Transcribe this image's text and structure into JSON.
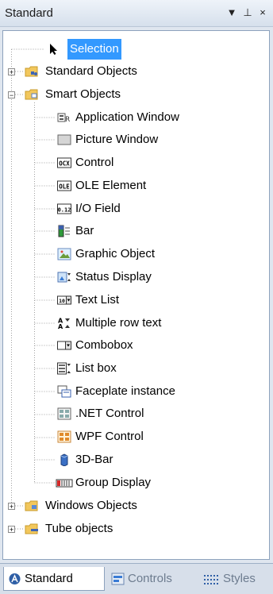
{
  "window": {
    "title": "Standard",
    "dropdown_glyph": "▼",
    "pin_glyph": "⊥",
    "close_glyph": "×"
  },
  "tree": {
    "nodes": [
      {
        "label": "Selection",
        "icon": "selection-arrow-icon",
        "level": 0,
        "expander": null,
        "selected": true
      },
      {
        "label": "Standard Objects",
        "icon": "standard-objects-folder-icon",
        "level": 0,
        "expander": "+"
      },
      {
        "label": "Smart Objects",
        "icon": "smart-objects-folder-icon",
        "level": 0,
        "expander": "−"
      },
      {
        "label": "Application Window",
        "icon": "application-window-icon",
        "level": 1
      },
      {
        "label": "Picture Window",
        "icon": "picture-window-icon",
        "level": 1
      },
      {
        "label": "Control",
        "icon": "ocx-control-icon",
        "level": 1,
        "badge": "OCX"
      },
      {
        "label": "OLE Element",
        "icon": "ole-element-icon",
        "level": 1,
        "badge": "OLE"
      },
      {
        "label": "I/O Field",
        "icon": "io-field-icon",
        "level": 1,
        "badge": "0.12"
      },
      {
        "label": "Bar",
        "icon": "bar-icon",
        "level": 1
      },
      {
        "label": "Graphic Object",
        "icon": "graphic-object-icon",
        "level": 1
      },
      {
        "label": "Status Display",
        "icon": "status-display-icon",
        "level": 1
      },
      {
        "label": "Text List",
        "icon": "text-list-icon",
        "level": 1
      },
      {
        "label": "Multiple row text",
        "icon": "multiple-row-text-icon",
        "level": 1
      },
      {
        "label": "Combobox",
        "icon": "combobox-icon",
        "level": 1
      },
      {
        "label": "List box",
        "icon": "list-box-icon",
        "level": 1
      },
      {
        "label": "Faceplate instance",
        "icon": "faceplate-instance-icon",
        "level": 1
      },
      {
        "label": ".NET Control",
        "icon": "net-control-icon",
        "level": 1
      },
      {
        "label": "WPF Control",
        "icon": "wpf-control-icon",
        "level": 1
      },
      {
        "label": "3D-Bar",
        "icon": "3d-bar-icon",
        "level": 1
      },
      {
        "label": "Group Display",
        "icon": "group-display-icon",
        "level": 1
      },
      {
        "label": "Windows Objects",
        "icon": "windows-objects-folder-icon",
        "level": 0,
        "expander": "+"
      },
      {
        "label": "Tube objects",
        "icon": "tube-objects-folder-icon",
        "level": 0,
        "expander": "+"
      }
    ]
  },
  "tabs": [
    {
      "label": "Standard",
      "icon": "standard-tab-icon",
      "active": true
    },
    {
      "label": "Controls",
      "icon": "controls-tab-icon",
      "active": false
    },
    {
      "label": "Styles",
      "icon": "styles-tab-icon",
      "active": false
    }
  ],
  "colors": {
    "selection": "#3399ff",
    "folder": "#f2c75c",
    "accent_blue": "#2f5fa6"
  }
}
